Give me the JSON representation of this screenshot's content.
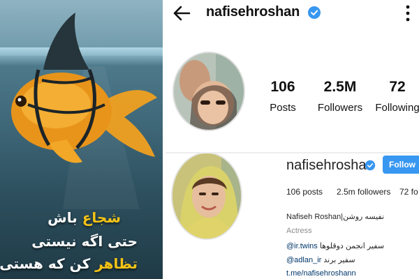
{
  "poster": {
    "line1_highlight": "شجاع",
    "line1_rest": "باش",
    "line2": "حتی اگه نیستی",
    "line3_highlight": "تظاهر",
    "line3_rest": "کن که هستی",
    "colors": {
      "text": "#ffffff",
      "highlight": "#f3c316",
      "fish": "#e89a1a",
      "fin": "#2a3a40"
    }
  },
  "top_profile": {
    "username": "nafisehroshan",
    "verified": true,
    "stats": {
      "posts": {
        "value": "106",
        "label": "Posts"
      },
      "followers": {
        "value": "2.5M",
        "label": "Followers"
      },
      "following": {
        "value": "72",
        "label": "Following"
      }
    },
    "icons": [
      "back-arrow-icon",
      "verified-badge-icon",
      "more-options-icon"
    ]
  },
  "bottom_profile": {
    "username": "nafisehroshan",
    "verified": true,
    "follow_label": "Follow",
    "stats_text": {
      "posts": "106 posts",
      "followers": "2.5m followers",
      "following": "72 fo"
    },
    "bio": {
      "name": "Nafiseh Roshan|نفیسه روشن",
      "category": "Actress",
      "line3_text": "سفیر انجمن دوقلوها",
      "line3_handle": "@ir.twins",
      "line4_text": "سفیر برند",
      "line4_handle": "@adlan_ir",
      "link": "t.me/nafisehroshann"
    },
    "accent": "#3897f0"
  }
}
